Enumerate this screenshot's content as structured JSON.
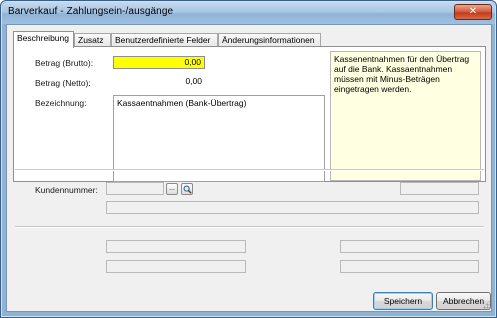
{
  "window": {
    "title": "Barverkauf - Zahlungsein-/ausgänge",
    "close_glyph": "✕"
  },
  "tabs": [
    {
      "label": "Beschreibung",
      "active": true
    },
    {
      "label": "Zusatz",
      "active": false
    },
    {
      "label": "Benutzerdefinierte Felder",
      "active": false
    },
    {
      "label": "Änderungsinformationen",
      "active": false
    }
  ],
  "form": {
    "betrag_brutto_label": "Betrag (Brutto):",
    "betrag_brutto_value": "0,00",
    "betrag_netto_label": "Betrag (Netto):",
    "betrag_netto_value": "0,00",
    "bezeichnung_label": "Bezeichnung:",
    "bezeichnung_value": "Kassaentnahmen (Bank-Übertrag)",
    "info_text": "Kassenentnahmen für den Übertrag auf die Bank. Kassaentnahmen müssen mit Minus-Beträgen eingetragen werden.",
    "highlight_color": "#ffff00",
    "info_bg_color": "#ffffe1"
  },
  "customer": {
    "label": "Kundennummer:",
    "browse_glyph": "...",
    "search_icon": "search-icon"
  },
  "buttons": {
    "save": "Speichern",
    "cancel": "Abbrechen"
  }
}
